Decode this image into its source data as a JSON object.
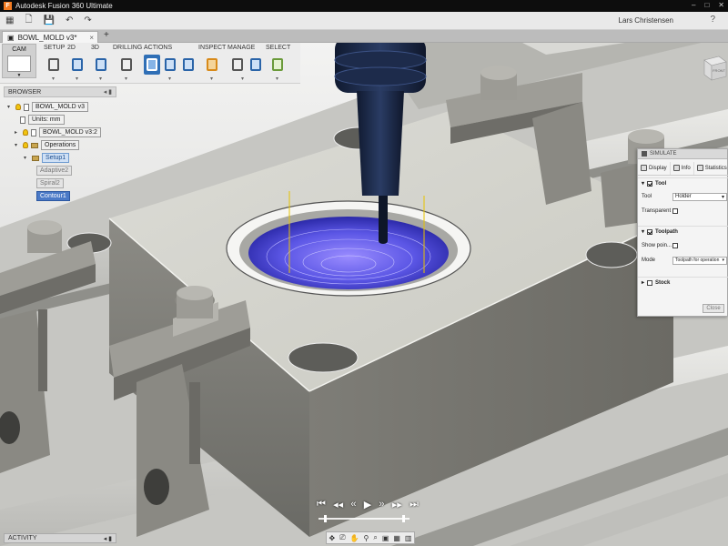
{
  "window": {
    "title": "Autodesk Fusion 360 Ultimate",
    "min": "–",
    "max": "□",
    "close": "✕"
  },
  "qat": {
    "user": "Lars Christensen",
    "help": "?"
  },
  "doc_tab": {
    "name": "BOWL_MOLD v3*",
    "close": "×",
    "new": "+"
  },
  "workspace": {
    "label": "CAM",
    "arrow": "▼"
  },
  "ribbon": {
    "groups": [
      {
        "label": "SETUP"
      },
      {
        "label": "2D"
      },
      {
        "label": "3D"
      },
      {
        "label": "DRILLING"
      },
      {
        "label": "ACTIONS"
      },
      {
        "label": "INSPECT"
      },
      {
        "label": "MANAGE"
      },
      {
        "label": "SELECT"
      }
    ],
    "dropdown": "▾"
  },
  "browser": {
    "title": "BROWSER",
    "controls": "◂ ▮",
    "items": [
      {
        "label": "BOWL_MOLD v3"
      },
      {
        "label": "Units: mm"
      },
      {
        "label": "BOWL_MOLD v3:2"
      },
      {
        "label": "Operations"
      },
      {
        "label": "Setup1"
      },
      {
        "label": "Adaptive2"
      },
      {
        "label": "Spiral2"
      },
      {
        "label": "Contour1"
      }
    ]
  },
  "simulate": {
    "title": "SIMULATE",
    "tabs": [
      {
        "label": "Display"
      },
      {
        "label": "Info"
      },
      {
        "label": "Statistics"
      }
    ],
    "tool_section": "Tool",
    "tool_label": "Tool",
    "tool_value": "Holder",
    "transparent_label": "Transparent",
    "toolpath_section": "Toolpath",
    "show_points_label": "Show poin...",
    "mode_label": "Mode",
    "mode_value": "Toolpath for operation",
    "stock_section": "Stock",
    "close_label": "Close",
    "caret": "▾"
  },
  "view_cube": {
    "label": "FRONT"
  },
  "activity": {
    "label": "ACTIVITY",
    "controls": "◂ ▮"
  },
  "playback": {
    "b1": "⏮",
    "b2": "◂◂",
    "b3": "«",
    "b4": "▶",
    "b5": "»",
    "b6": "▸▸",
    "b7": "⏭"
  },
  "navbar": {
    "icons": [
      "✥",
      "⎚",
      "✋",
      "⚲",
      "⌕",
      "▣",
      "▦",
      "▥"
    ]
  },
  "colors": {
    "accent": "#2f6fb6",
    "toolpath": "#5a58e6",
    "tool": "#1c2a45"
  }
}
